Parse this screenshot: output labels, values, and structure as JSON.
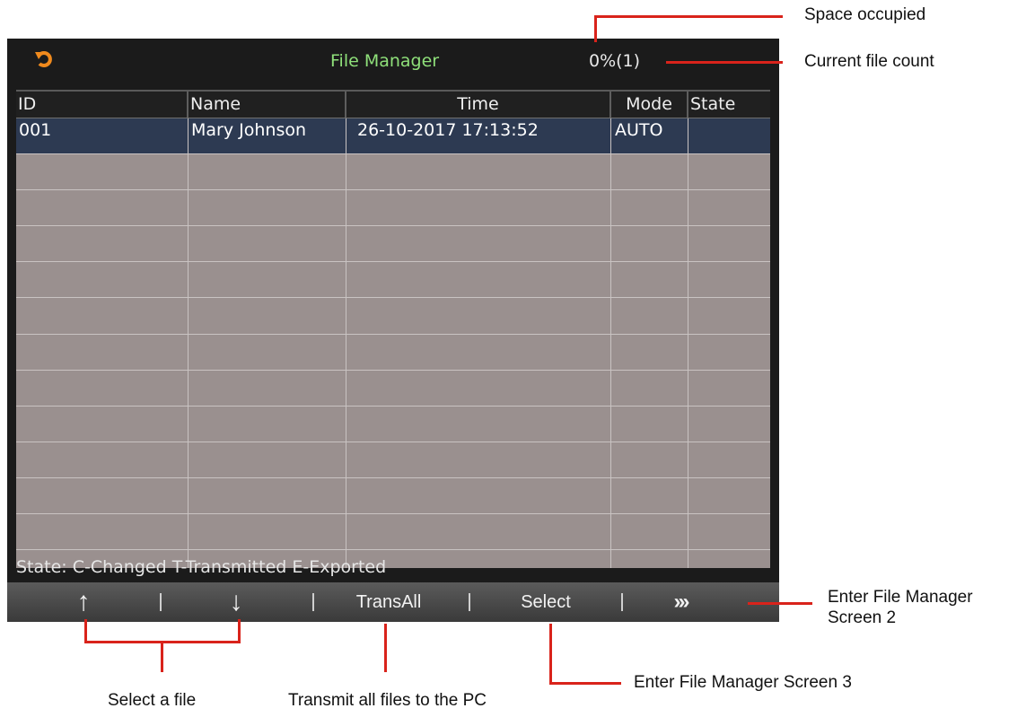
{
  "screen": {
    "title": "File Manager",
    "usage": "0%(1)",
    "columns": [
      "ID",
      "Name",
      "Time",
      "Mode",
      "State"
    ],
    "rows": [
      {
        "id": "001",
        "name": "Mary Johnson",
        "time": "26-10-2017 17:13:52",
        "mode": "AUTO",
        "state": ""
      }
    ],
    "legend": "State: C-Changed T-Transmitted E-Exported",
    "softkeys": {
      "up": "↑",
      "down": "↓",
      "transall": "TransAll",
      "select": "Select",
      "next": "›››"
    }
  },
  "annotations": {
    "space_occupied": "Space occupied",
    "current_file_count": "Current file count",
    "enter_screen2_line1": "Enter File Manager",
    "enter_screen2_line2": "Screen 2",
    "enter_screen3": "Enter File Manager Screen 3",
    "select_file": "Select a file",
    "transmit_all": "Transmit all files to the PC"
  },
  "colors": {
    "annotation_line": "#d9231b",
    "title_green": "#8fe07a",
    "selected_row": "#2d3a52",
    "table_bg": "#9a908f"
  },
  "icons": {
    "back": "back-arrow-icon"
  }
}
